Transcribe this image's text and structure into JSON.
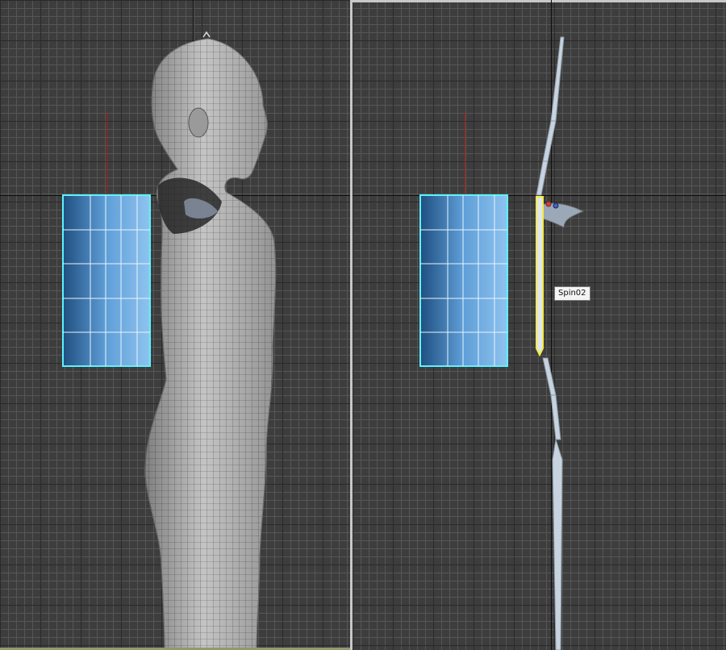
{
  "viewports": [
    {
      "id": "left",
      "label": "",
      "content": "character-mesh-with-proxy-box"
    },
    {
      "id": "right",
      "label": "",
      "content": "biped-bones-with-proxy-box"
    }
  ],
  "selection": {
    "tooltip": "Spin02",
    "highlight_color": "#f5ec45"
  },
  "colors": {
    "viewport_bg": "#3d3d3d",
    "grid_minor": "#565656",
    "grid_major": "#2a2a2a",
    "box_outline": "#5cf2ff",
    "box_fill": "#5a9bd6",
    "mesh_fill": "#bfbfbf",
    "bone_fill": "#c7d3de"
  }
}
